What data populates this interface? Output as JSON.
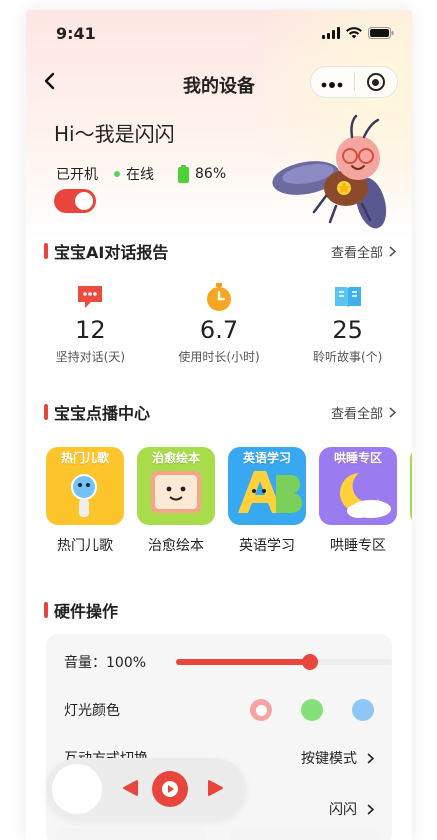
{
  "status_bar": {
    "time": "9:41"
  },
  "navbar": {
    "title": "我的设备"
  },
  "device": {
    "greeting": "Hi～我是闪闪",
    "power_label": "已开机",
    "online_label": "在线",
    "battery": "86%",
    "power_on": true
  },
  "report": {
    "title": "宝宝AI对话报告",
    "view_all": "查看全部",
    "stats": [
      {
        "icon": "chat-bubble-icon",
        "value": "12",
        "label": "坚持对话(天)"
      },
      {
        "icon": "timer-icon",
        "value": "6.7",
        "label": "使用时长(小时)"
      },
      {
        "icon": "book-icon",
        "value": "25",
        "label": "聆听故事(个)"
      }
    ]
  },
  "vod": {
    "title": "宝宝点播中心",
    "view_all": "查看全部",
    "items": [
      {
        "cover_title": "热门儿歌",
        "label": "热门儿歌",
        "color": "#fdc52c"
      },
      {
        "cover_title": "治愈绘本",
        "label": "治愈绘本",
        "color": "#a8dc4a"
      },
      {
        "cover_title": "英语学习",
        "label": "英语学习",
        "color": "#38a8f0"
      },
      {
        "cover_title": "哄睡专区",
        "label": "哄睡专区",
        "color": "#9b7bf0"
      }
    ]
  },
  "hardware": {
    "title": "硬件操作",
    "volume_label": "音量：100%",
    "volume": 0.62,
    "light_label": "灯光颜色",
    "light_colors": [
      "#f7a3a3",
      "#86e07a",
      "#8ec6f5"
    ],
    "interaction_label": "互动方式切换",
    "interaction_value": "按键模式",
    "name_value": "闪闪"
  },
  "colors": {
    "accent": "#e8463c"
  }
}
